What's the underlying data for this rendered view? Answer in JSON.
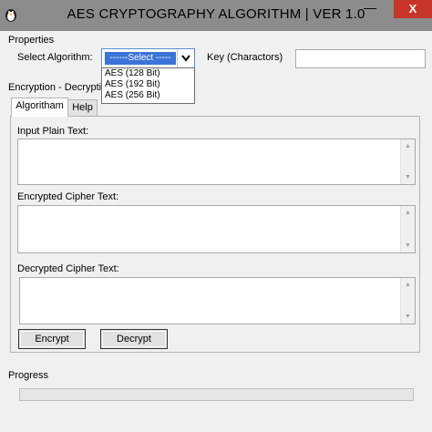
{
  "window": {
    "title": "AES CRYPTOGRAPHY ALGORITHM | VER 1.0",
    "minimize_label": "—",
    "close_label": "X"
  },
  "properties": {
    "group_label": "Properties",
    "select_algorithm_label": "Select Algorithm:",
    "select_value": "------Select -----",
    "options": [
      "AES (128 Bit)",
      "AES (192 Bit)",
      "AES (256 Bit)"
    ],
    "key_label": "Key (Charactors)",
    "key_value": ""
  },
  "encryption": {
    "group_label": "Encryption - Decryption",
    "tabs": [
      "Algoritham",
      "Help"
    ],
    "input_plain_label": "Input Plain  Text:",
    "input_plain_value": "",
    "encrypted_label": "Encrypted Cipher Text:",
    "encrypted_value": "",
    "decrypted_label": "Decrypted Cipher Text:",
    "decrypted_value": "",
    "encrypt_button": "Encrypt",
    "decrypt_button": "Decrypt"
  },
  "progress": {
    "label": "Progress",
    "value": 0
  },
  "icons": {
    "scroll_up": "▲",
    "scroll_down": "▼",
    "select_arrow": "⌄"
  }
}
